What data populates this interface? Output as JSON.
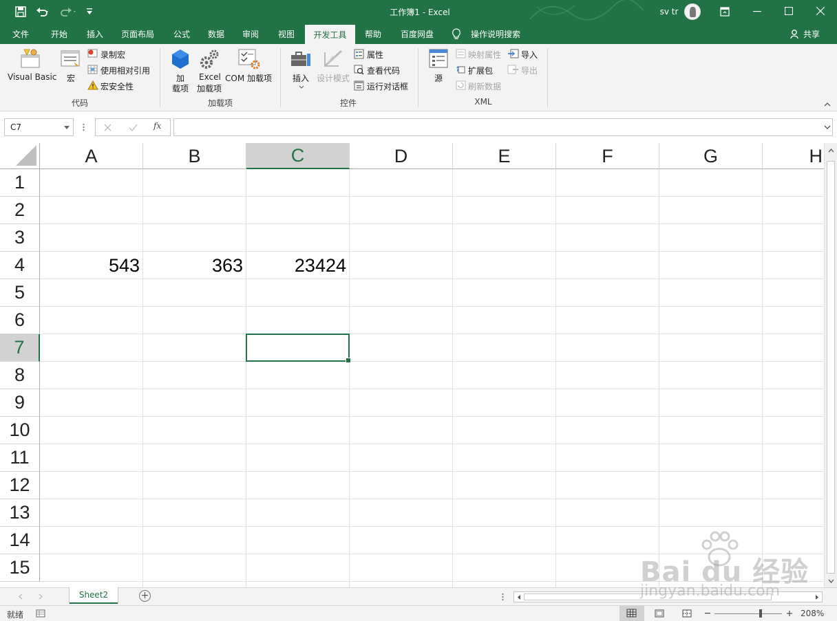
{
  "titlebar": {
    "title": "工作簿1 - Excel",
    "user": "sv tr",
    "restore_icon": "ribbon-display-options-icon"
  },
  "tabs": [
    "文件",
    "开始",
    "插入",
    "页面布局",
    "公式",
    "数据",
    "审阅",
    "视图",
    "开发工具",
    "帮助",
    "百度网盘",
    "操作说明搜索"
  ],
  "share_label": "共享",
  "ribbon": {
    "code": {
      "vb_label": "Visual Basic",
      "macro_label": "宏",
      "record": "录制宏",
      "relative": "使用相对引用",
      "security": "宏安全性",
      "group": "代码"
    },
    "addins": {
      "addins_l1": "加",
      "addins_l2": "载项",
      "excel_l1": "Excel",
      "excel_l2": "加载项",
      "com_label": "COM 加载项",
      "group": "加载项"
    },
    "controls": {
      "insert": "插入",
      "design_mode": "设计模式",
      "properties": "属性",
      "view_code": "查看代码",
      "run_dialog": "运行对话框",
      "group": "控件"
    },
    "xml": {
      "source": "源",
      "map_props": "映射属性",
      "expansion": "扩展包",
      "refresh": "刷新数据",
      "import": "导入",
      "export": "导出",
      "group": "XML"
    }
  },
  "formula_bar": {
    "name_box": "C7",
    "fx": "fx",
    "value": ""
  },
  "grid": {
    "columns": [
      "A",
      "B",
      "C",
      "D",
      "E",
      "F",
      "G",
      "H"
    ],
    "rows": [
      "1",
      "2",
      "3",
      "4",
      "5",
      "6",
      "7",
      "8",
      "9",
      "10",
      "11",
      "12",
      "13",
      "14",
      "15"
    ],
    "selected_column": "C",
    "selected_row": "7",
    "cells": {
      "A4": "543",
      "B4": "363",
      "C4": "23424"
    }
  },
  "sheets": [
    "Sheet2"
  ],
  "status": {
    "ready": "就绪",
    "zoom": "208%"
  },
  "watermark": {
    "logo": "Bai du 经验",
    "url": "jingyan.baidu.com"
  }
}
